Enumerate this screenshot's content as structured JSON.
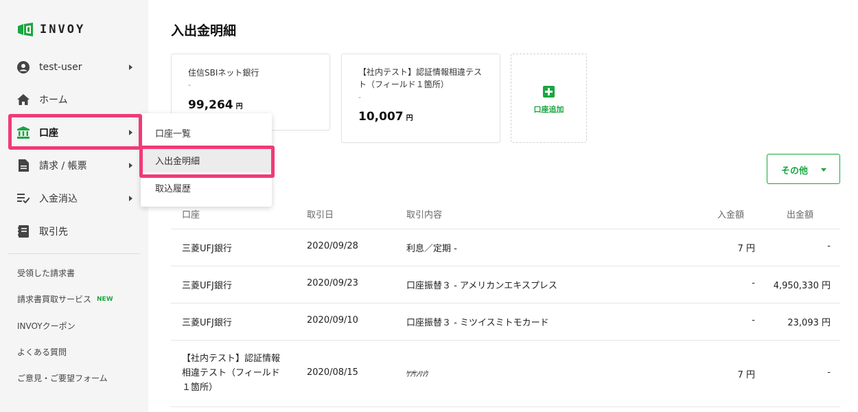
{
  "app": {
    "name": "INVOY"
  },
  "colors": {
    "brand_green": "#1aa640",
    "highlight_pink": "#ef3b77",
    "sidebar_bg": "#f5f5f5"
  },
  "sidebar": {
    "user": {
      "label": "test-user",
      "icon": "user-circle-icon"
    },
    "items": [
      {
        "label": "ホーム",
        "icon": "home-icon"
      },
      {
        "label": "口座",
        "icon": "bank-icon"
      },
      {
        "label": "請求 / 帳票",
        "icon": "document-icon"
      },
      {
        "label": "入金消込",
        "icon": "list-check-icon"
      },
      {
        "label": "取引先",
        "icon": "contact-book-icon"
      }
    ],
    "links": [
      {
        "label": "受領した請求書"
      },
      {
        "label": "請求書買取サービス",
        "badge": "NEW"
      },
      {
        "label": "INVOYクーポン"
      },
      {
        "label": "よくある質問"
      },
      {
        "label": "ご意見・ご要望フォーム"
      }
    ]
  },
  "dropdown": {
    "items": [
      {
        "label": "口座一覧"
      },
      {
        "label": "入出金明細"
      },
      {
        "label": "取込履歴"
      }
    ]
  },
  "main": {
    "title": "入出金明細",
    "cards": [
      {
        "bank": "住信SBIネット銀行",
        "sub": "-",
        "amount": "99,264",
        "unit": "円"
      },
      {
        "bank_line1": "【社内テスト】認証情報相違テス",
        "bank_line2": "ト（フィールド１箇所）",
        "sub": "-",
        "amount": "10,007",
        "unit": "円"
      }
    ],
    "add_account_label": "口座追加",
    "other_button_label": "その他",
    "table": {
      "headers": {
        "account": "口座",
        "date": "取引日",
        "description": "取引内容",
        "deposit": "入金額",
        "withdrawal": "出金額"
      },
      "rows": [
        {
          "account": "三菱UFJ銀行",
          "date": "2020/09/28",
          "description": "利息／定期 -",
          "deposit": "7 円",
          "withdrawal": "-"
        },
        {
          "account": "三菱UFJ銀行",
          "date": "2020/09/23",
          "description": "口座振替３ - アメリカンエキスプレス",
          "deposit": "-",
          "withdrawal": "4,950,330 円"
        },
        {
          "account": "三菱UFJ銀行",
          "date": "2020/09/10",
          "description": "口座振替３ - ミツイスミトモカード",
          "deposit": "-",
          "withdrawal": "23,093 円"
        },
        {
          "account_line1": "【社内テスト】認証情報",
          "account_line2": "相違テスト（フィールド",
          "account_line3": "１箇所）",
          "date": "2020/08/15",
          "description": "ｹﾂｻﾝﾘｿｸ",
          "deposit": "7 円",
          "withdrawal": "-"
        }
      ]
    }
  }
}
